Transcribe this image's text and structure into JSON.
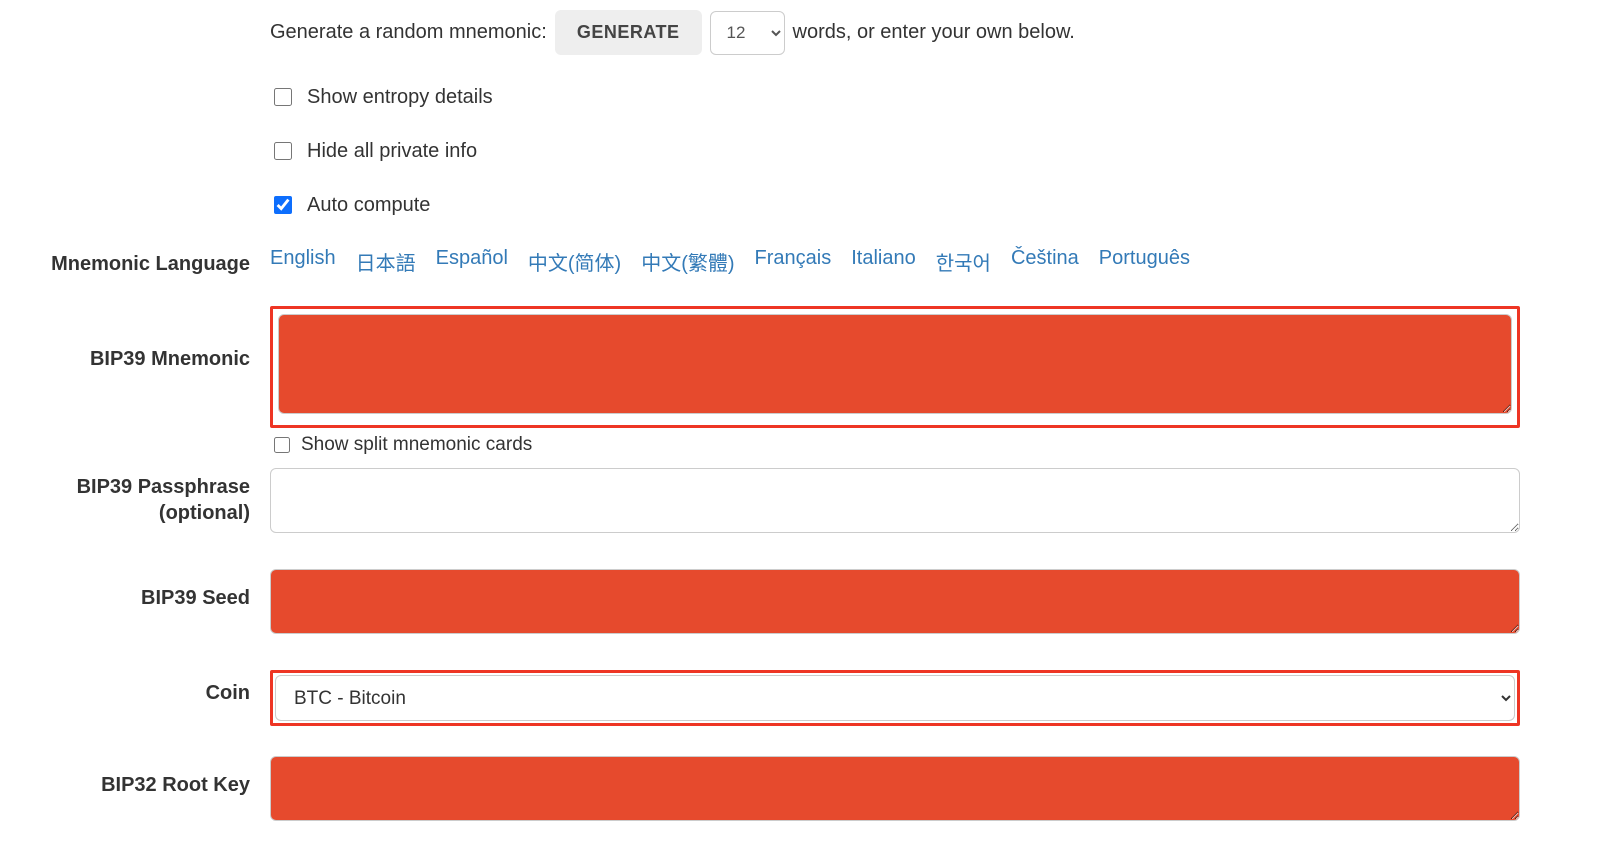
{
  "generate": {
    "prefix_text": "Generate a random mnemonic:",
    "button_label": "GENERATE",
    "word_count": "12",
    "suffix_text": "words, or enter your own below."
  },
  "checkboxes": {
    "entropy_label": "Show entropy details",
    "entropy_checked": false,
    "hide_private_label": "Hide all private info",
    "hide_private_checked": false,
    "auto_compute_label": "Auto compute",
    "auto_compute_checked": true,
    "split_cards_label": "Show split mnemonic cards",
    "split_cards_checked": false
  },
  "labels": {
    "mnemonic_language": "Mnemonic Language",
    "bip39_mnemonic": "BIP39 Mnemonic",
    "bip39_passphrase": "BIP39 Passphrase (optional)",
    "bip39_seed": "BIP39 Seed",
    "coin": "Coin",
    "bip32_root_key": "BIP32 Root Key"
  },
  "languages": [
    "English",
    "日本語",
    "Español",
    "中文(简体)",
    "中文(繁體)",
    "Français",
    "Italiano",
    "한국어",
    "Čeština",
    "Português"
  ],
  "fields": {
    "mnemonic_value": "",
    "passphrase_value": "",
    "seed_value": "",
    "root_key_value": ""
  },
  "coin": {
    "selected": "BTC - Bitcoin"
  }
}
